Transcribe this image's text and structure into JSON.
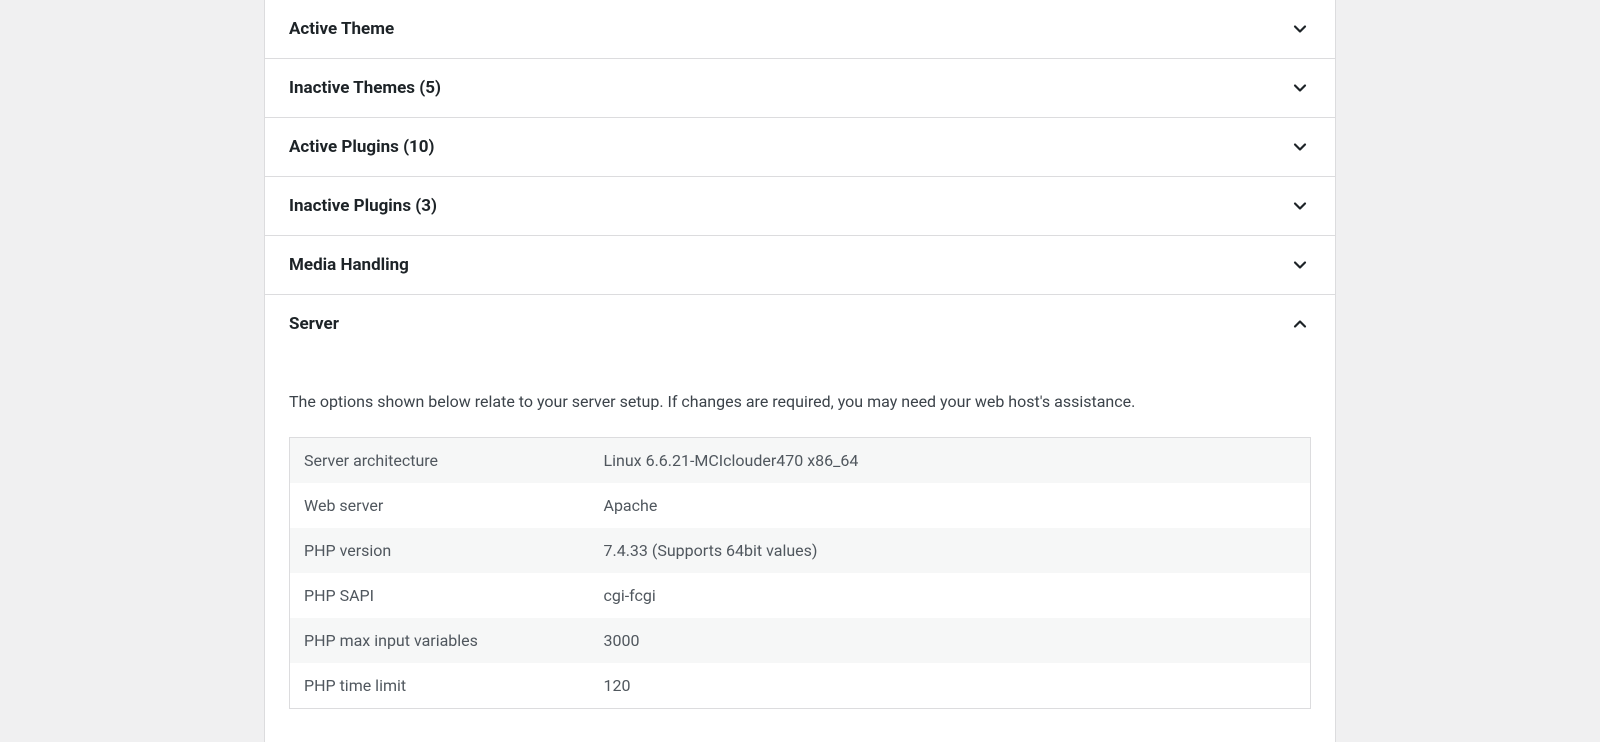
{
  "sections": {
    "active_theme": {
      "title": "Active Theme"
    },
    "inactive_themes": {
      "title": "Inactive Themes (5)"
    },
    "active_plugins": {
      "title": "Active Plugins (10)"
    },
    "inactive_plugins": {
      "title": "Inactive Plugins (3)"
    },
    "media_handling": {
      "title": "Media Handling"
    },
    "server": {
      "title": "Server",
      "description": "The options shown below relate to your server setup. If changes are required, you may need your web host's assistance.",
      "rows": [
        {
          "label": "Server architecture",
          "value": "Linux 6.6.21-MCIclouder470 x86_64"
        },
        {
          "label": "Web server",
          "value": "Apache"
        },
        {
          "label": "PHP version",
          "value": "7.4.33 (Supports 64bit values)"
        },
        {
          "label": "PHP SAPI",
          "value": "cgi-fcgi"
        },
        {
          "label": "PHP max input variables",
          "value": "3000"
        },
        {
          "label": "PHP time limit",
          "value": "120"
        }
      ]
    }
  }
}
